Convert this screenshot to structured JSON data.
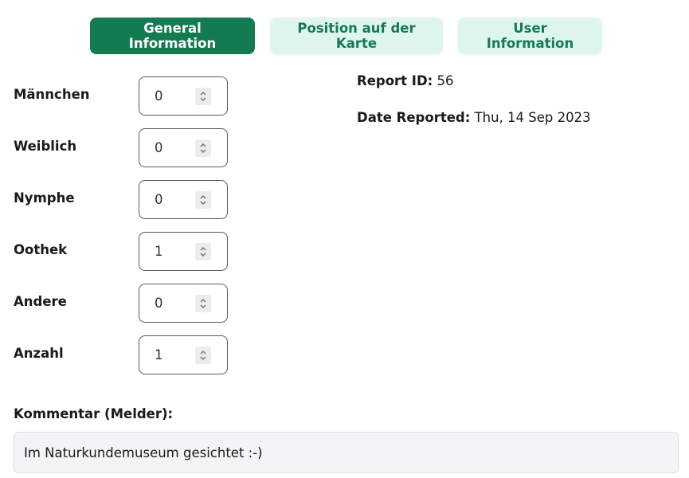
{
  "tabs": [
    {
      "label": "General Information",
      "active": true
    },
    {
      "label": "Position auf der Karte",
      "active": false
    },
    {
      "label": "User Information",
      "active": false
    }
  ],
  "counters": [
    {
      "label": "Männchen",
      "value": "0"
    },
    {
      "label": "Weiblich",
      "value": "0"
    },
    {
      "label": "Nymphe",
      "value": "0"
    },
    {
      "label": "Oothek",
      "value": "1"
    },
    {
      "label": "Andere",
      "value": "0"
    },
    {
      "label": "Anzahl",
      "value": "1"
    }
  ],
  "info": {
    "report_id_label": "Report ID:",
    "report_id_value": "56",
    "date_label": "Date Reported:",
    "date_value": "Thu, 14 Sep 2023"
  },
  "comment": {
    "label": "Kommentar (Melder):",
    "value": "Im Naturkundemuseum gesichtet :-)"
  },
  "colors": {
    "primary": "#137a52",
    "tab_inactive_bg": "#dff6ec",
    "comment_bg": "#f4f4f6"
  }
}
